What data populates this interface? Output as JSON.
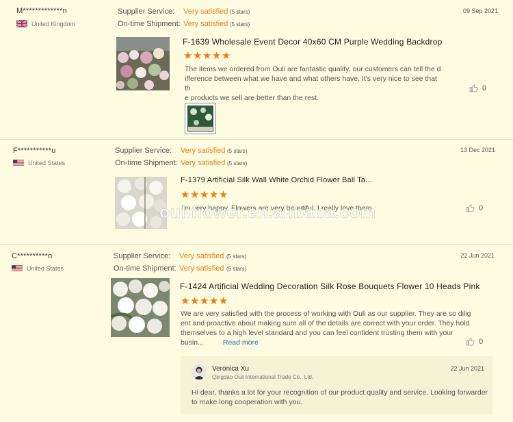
{
  "reviews": [
    {
      "reviewer": "M*************n",
      "country": "United Kingdom",
      "supplier_label": "Supplier Service:",
      "supplier_value": "Very satisfied",
      "supplier_stars": "(5 stars)",
      "shipment_label": "On-time Shipment:",
      "shipment_value": "Very satisfied",
      "shipment_stars": "(5 stars)",
      "date": "09 Sep 2021",
      "product_title": "F-1639 Wholesale Event Decor 40x60 CM Purple Wedding Backdrop",
      "rating": 5,
      "text_lines": [
        "The items we ordered from Ouli  are fantastic quality, our customers can tell the d",
        "ifference between what we have and what others have. It's very nice to see that th",
        "e products we sell are better than the rest."
      ],
      "likes": "0"
    },
    {
      "reviewer": "F***********u",
      "country": "United States",
      "supplier_label": "Supplier Service:",
      "supplier_value": "Very satisfied",
      "supplier_stars": "(5 stars)",
      "shipment_label": "On-time Shipment:",
      "shipment_value": "Very satisfied",
      "shipment_stars": "(5 stars)",
      "date": "13 Dec 2021",
      "product_title": "F-1379 Artificial Silk Wall White Orchid Flower Ball Ta...",
      "rating": 5,
      "text_lines": [
        "I'm very happy. Flowers are very beautiful. I really love them"
      ],
      "likes": "0"
    },
    {
      "reviewer": "C**********n",
      "country": "United States",
      "supplier_label": "Supplier Service:",
      "supplier_value": "Very satisfied",
      "supplier_stars": "(5 stars)",
      "shipment_label": "On-time Shipment:",
      "shipment_value": "Very satisfied",
      "shipment_stars": "(5 stars)",
      "date": "22 Jun 2021",
      "product_title": "F-1424 Artificial Wedding Decoration Silk Rose Bouquets Flower 10 Heads Pink",
      "rating": 5,
      "text_lines": [
        "We are very satisfied with the process of working with Ouli as our supplier. They are so dilig",
        "ent and proactive about making sure all of the details are correct with your order. They hold",
        "themselves to a high level standard and you can feel confident trusting them with your",
        "busin..."
      ],
      "read_more": "Read more",
      "likes": "0",
      "reply": {
        "name": "Veronica Xu",
        "company": "Qingdao Ouli International Trade Co., Ltd.",
        "date": "22 Jun 2021",
        "text_lines": [
          "Hi dear, thanks a lot for your recognition of our product quality and  service. Looking forwarder",
          "to make long cooperation with you."
        ]
      }
    }
  ],
  "watermark": "oulifiower.en.alibaba.com",
  "colors": {
    "background": "#fdfbe0",
    "accent": "#e87f16",
    "star": "#f27b12",
    "link": "#2a6ebb"
  },
  "star_glyph": "★",
  "like_icon": "thumbs-up-icon"
}
